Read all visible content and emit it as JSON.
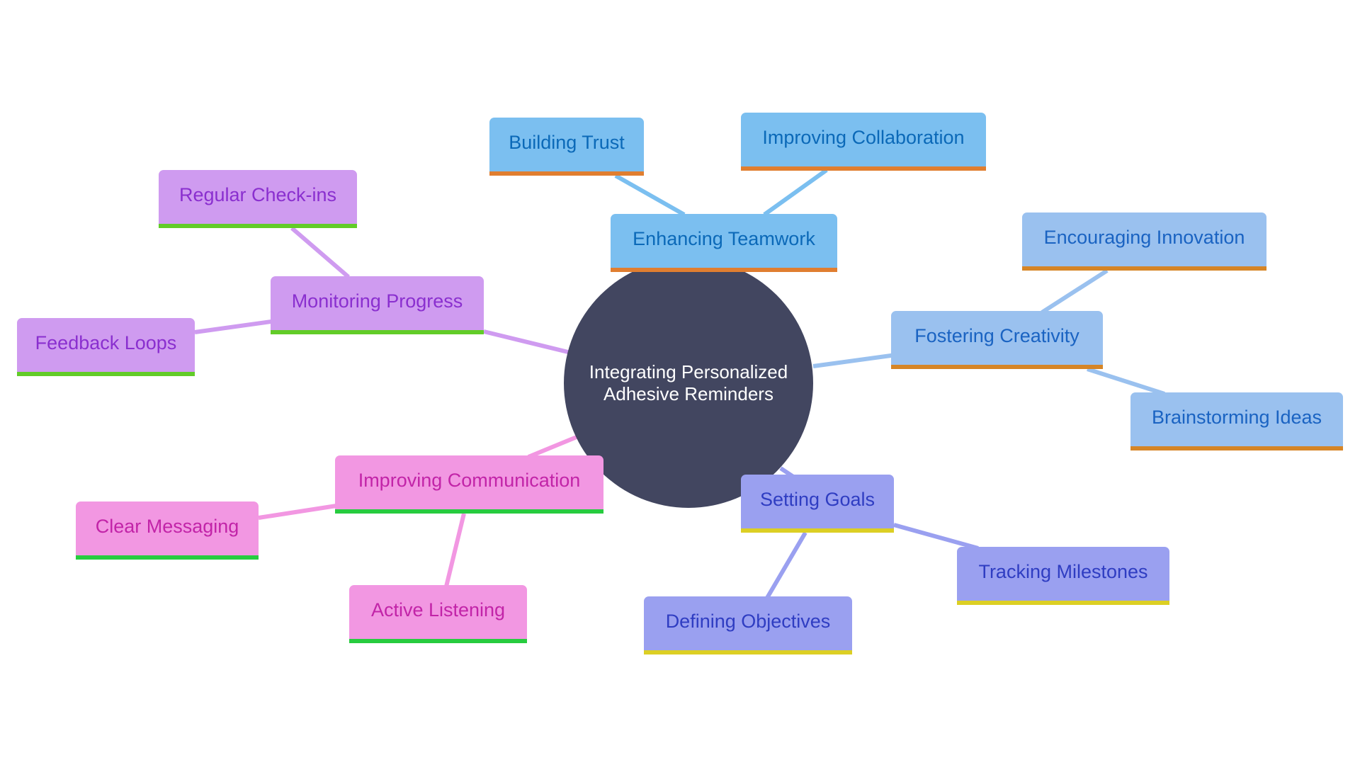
{
  "diagram": {
    "type": "mindmap",
    "center": {
      "label_line1": "Integrating Personalized",
      "label_line2": "Adhesive Reminders",
      "color": "#424660"
    },
    "branches": [
      {
        "id": "enhancing-teamwork",
        "label": "Enhancing Teamwork",
        "fill": "#7bbff0",
        "text": "#0b69b8",
        "underline": "#e07e30",
        "children": [
          {
            "id": "building-trust",
            "label": "Building Trust"
          },
          {
            "id": "improving-collaboration",
            "label": "Improving Collaboration"
          }
        ]
      },
      {
        "id": "fostering-creativity",
        "label": "Fostering Creativity",
        "fill": "#9ac1ef",
        "text": "#1a63c2",
        "underline": "#d68526",
        "children": [
          {
            "id": "encouraging-innovation",
            "label": "Encouraging Innovation"
          },
          {
            "id": "brainstorming-ideas",
            "label": "Brainstorming Ideas"
          }
        ]
      },
      {
        "id": "setting-goals",
        "label": "Setting Goals",
        "fill": "#9aa0f0",
        "text": "#2f3dc2",
        "underline": "#dccf24",
        "children": [
          {
            "id": "tracking-milestones",
            "label": "Tracking Milestones"
          },
          {
            "id": "defining-objectives",
            "label": "Defining Objectives"
          }
        ]
      },
      {
        "id": "improving-communication",
        "label": "Improving Communication",
        "fill": "#f297e2",
        "text": "#c224a8",
        "underline": "#27cc3f",
        "children": [
          {
            "id": "clear-messaging",
            "label": "Clear Messaging"
          },
          {
            "id": "active-listening",
            "label": "Active Listening"
          }
        ]
      },
      {
        "id": "monitoring-progress",
        "label": "Monitoring Progress",
        "fill": "#cf9bf0",
        "text": "#8a2fcf",
        "underline": "#62cc28",
        "children": [
          {
            "id": "regular-check-ins",
            "label": "Regular Check-ins"
          },
          {
            "id": "feedback-loops",
            "label": "Feedback Loops"
          }
        ]
      }
    ]
  }
}
